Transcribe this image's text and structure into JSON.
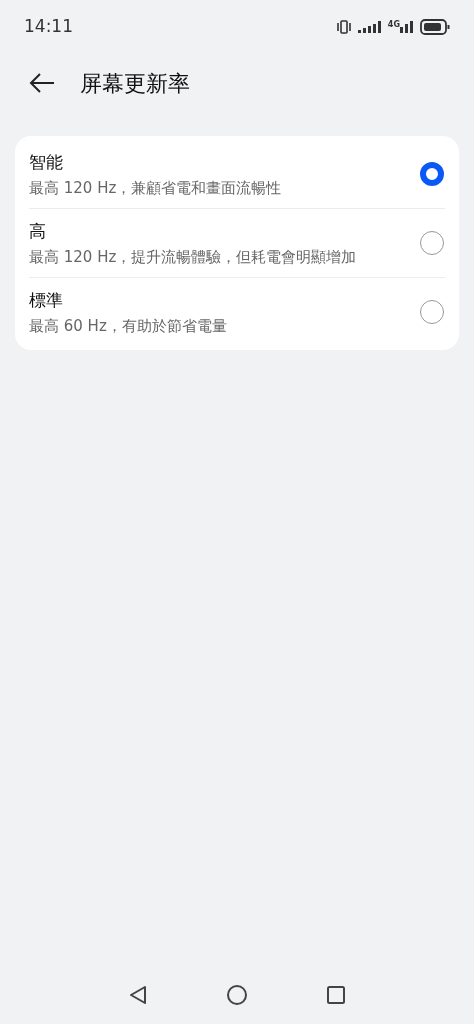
{
  "status_bar": {
    "time": "14:11",
    "network": "4G"
  },
  "header": {
    "title": "屏幕更新率"
  },
  "options": [
    {
      "label": "智能",
      "description": "最高 120 Hz，兼顧省電和畫面流暢性",
      "selected": true
    },
    {
      "label": "高",
      "description": "最高 120 Hz，提升流暢體驗，但耗電會明顯增加",
      "selected": false
    },
    {
      "label": "標準",
      "description": "最高 60 Hz，有助於節省電量",
      "selected": false
    }
  ]
}
